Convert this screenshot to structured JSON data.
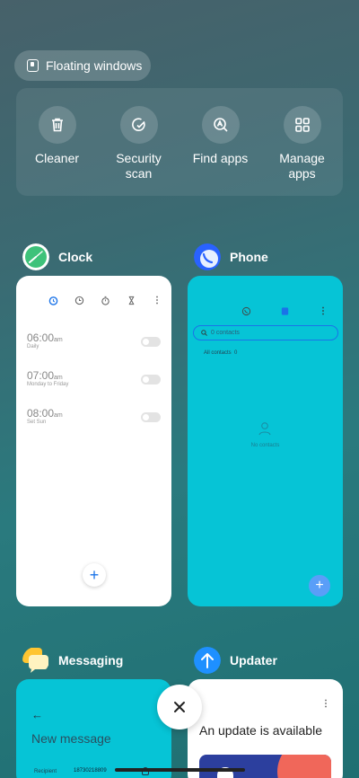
{
  "floating_windows": {
    "label": "Floating windows"
  },
  "tools": [
    {
      "label": "Cleaner",
      "icon": "trash-icon"
    },
    {
      "label": "Security scan",
      "icon": "shield-check-icon"
    },
    {
      "label": "Find apps",
      "icon": "search-apps-icon"
    },
    {
      "label": "Manage apps",
      "icon": "grid-icon"
    }
  ],
  "apps": {
    "clock": {
      "name": "Clock",
      "alarms": [
        {
          "time": "06:00",
          "ampm": "am",
          "repeat": "Daily"
        },
        {
          "time": "07:00",
          "ampm": "am",
          "repeat": "Monday to Friday"
        },
        {
          "time": "08:00",
          "ampm": "am",
          "repeat": "Set Sun"
        }
      ]
    },
    "phone": {
      "name": "Phone",
      "search_placeholder": "0 contacts",
      "filter_label": "All contacts",
      "filter_count": "0",
      "empty_label": "No contacts"
    },
    "messaging": {
      "name": "Messaging",
      "title": "New message",
      "recipient_label": "Recipient",
      "recipient_value": "18730218809"
    },
    "updater": {
      "name": "Updater",
      "title": "An update is available"
    }
  },
  "colors": {
    "cyan_card": "#06c4d6",
    "accent_blue": "#1a73e8"
  }
}
